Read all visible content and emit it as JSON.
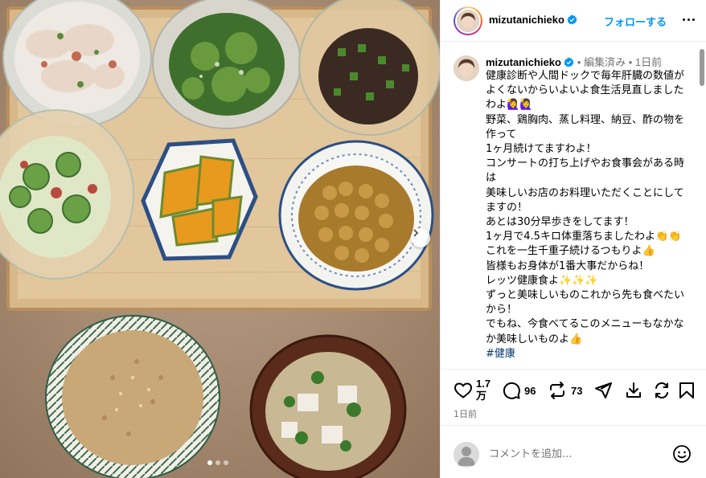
{
  "post": {
    "username": "mizutanichieko",
    "follow_label": "フォローする",
    "caption_meta": "• 編集済み • 1日前",
    "caption_text": "健康診断や人間ドックで毎年肝臓の数値がよくないからいよいよ食生活見直しましたわよ🙋‍♀️🙋‍♀️\n野菜、鶏胸肉、蒸し料理、納豆、酢の物を作って\n1ヶ月続けてますわよ！\nコンサートの打ち上げやお食事会がある時は\n美味しいお店のお料理いただくことにしてますの！\nあとは30分早歩きをしてます！\n1ヶ月で4.5キロ体重落ちましたわよ👏👏\nこれを一生千重子続けるつもりよ👍\n皆様もお身体が1番大事だからね！\nレッツ健康食よ✨✨✨\nずっと美味しいものこれから先も食べたいから！\nでもね、今食べてるこのメニューもなかなか美味しいものよ👍",
    "hashtag": "#健康",
    "likes": "1.7\n万",
    "comments_count": "96",
    "reposts_count": "73",
    "date": "1日前",
    "comment_placeholder": "コメントを追加...",
    "carousel": {
      "count": 3,
      "active": 1
    }
  },
  "icons": {
    "verified": "verified-badge-icon",
    "more": "more-options-icon",
    "like": "heart-icon",
    "comment": "comment-bubble-icon",
    "repost": "repost-icon",
    "share": "paper-plane-icon",
    "download": "download-icon",
    "remix": "remix-icon",
    "save": "bookmark-icon",
    "emoji": "emoji-smile-icon",
    "next": "chevron-right-icon"
  },
  "colors": {
    "link": "#0095f6",
    "verified": "#0095f6",
    "hashtag": "#00376b",
    "muted": "#737373"
  }
}
